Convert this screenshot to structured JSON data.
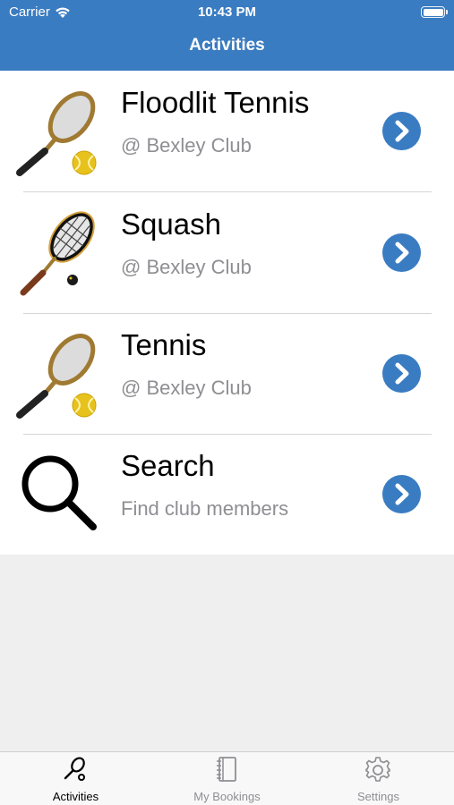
{
  "status_bar": {
    "carrier": "Carrier",
    "time": "10:43 PM",
    "battery_level": 1.0
  },
  "nav": {
    "title": "Activities"
  },
  "activities": [
    {
      "title": "Floodlit Tennis",
      "subtitle": "@ Bexley Club",
      "icon": "tennis-racket-icon"
    },
    {
      "title": "Squash",
      "subtitle": "@ Bexley Club",
      "icon": "squash-racket-icon"
    },
    {
      "title": "Tennis",
      "subtitle": "@ Bexley Club",
      "icon": "tennis-racket-icon"
    },
    {
      "title": "Search",
      "subtitle": "Find club members",
      "icon": "magnifier-icon"
    }
  ],
  "tabs": [
    {
      "label": "Activities",
      "icon": "activities-icon",
      "active": true
    },
    {
      "label": "My Bookings",
      "icon": "notebook-icon",
      "active": false
    },
    {
      "label": "Settings",
      "icon": "gear-icon",
      "active": false
    }
  ],
  "colors": {
    "nav_bar": "#3a7cc1",
    "chevron": "#3a7cc1",
    "background": "#efefef"
  }
}
